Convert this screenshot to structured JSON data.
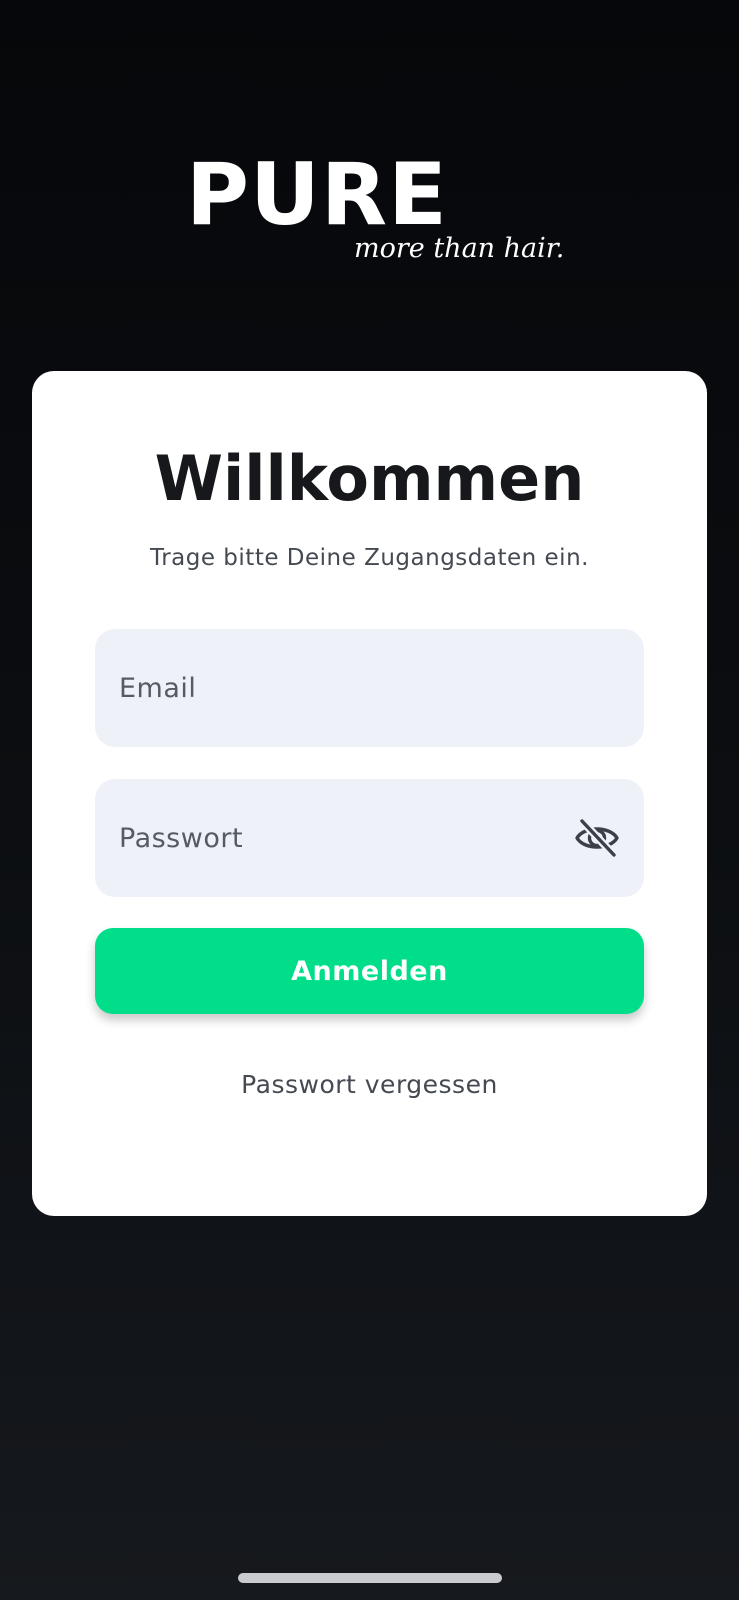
{
  "logo": {
    "brand": "PURE",
    "tagline": "more than hair."
  },
  "login": {
    "title": "Willkommen",
    "subtitle": "Trage bitte Deine Zugangsdaten ein.",
    "email": {
      "placeholder": "Email",
      "value": ""
    },
    "password": {
      "placeholder": "Passwort",
      "value": "",
      "visibility_icon": "eye-off-icon"
    },
    "submit_label": "Anmelden",
    "forgot_label": "Passwort vergessen"
  },
  "colors": {
    "accent": "#00de8a",
    "background": "#0b0d10",
    "card": "#ffffff",
    "field": "#eef1f7",
    "title": "#16181b",
    "text_muted": "#454a52"
  }
}
